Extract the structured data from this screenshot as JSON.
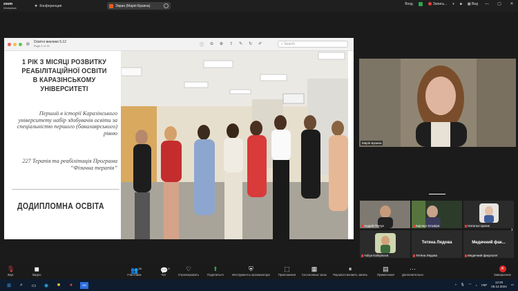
{
  "topbar": {
    "brand_line1": "zoom",
    "brand_line2": "Workplace",
    "conference_label": "Конференция",
    "share_label": "Экран (Марія Брзина)",
    "enter_label": "Вход",
    "record_label": "Запись...",
    "view_label": "Вид",
    "colors": {
      "record": "#e24040",
      "security": "#2ea44f"
    }
  },
  "viewer": {
    "doc_title": "Освітні виклики 5.12",
    "doc_subtitle": "Page 4 of 15",
    "search_placeholder": "Search"
  },
  "slide": {
    "title": "1 РІК З МІСЯЦІ РОЗВИТКУ РЕАБІЛІТАЦІЙНОЇ ОСВІТИ В КАРАЗІНСЬКОМУ УНІВЕРСИТЕТІ",
    "body": "Перший в історії Каразінського університету набір здобувачів освіти за спеціальністю першого (бакалаврського) рівню",
    "body2": "227 Терапія та реабілітація Програма “Фізична терапія”",
    "footer": "ДОДИПЛОМНА ОСВІТА"
  },
  "main_video": {
    "name": "Марія Брзина"
  },
  "participants": [
    {
      "name": "Андрій Пінчук",
      "muted": true
    },
    {
      "name": "Карчаус Ельвіра",
      "muted": true
    },
    {
      "name": "Наталья Цалик",
      "muted": true
    },
    {
      "name": "Yuliya Kalnytsova",
      "muted": true
    },
    {
      "name": "Тетяна Лядова",
      "display": "Тетяна Лядова",
      "muted": true
    },
    {
      "name": "Медичний факультет",
      "display": "Медичний фак...",
      "muted": true
    }
  ],
  "toolbar": {
    "audio": "Звук",
    "video": "Видео",
    "participants": "Участники",
    "participants_count": "20",
    "chat": "Чат",
    "chat_count": "3",
    "react": "Отреагировать",
    "share": "Поделиться",
    "host_tools": "Инструменты организатора",
    "apps": "Приложения",
    "rooms": "Сессионные залы",
    "pause_share": "Пауза/остановить запись",
    "notes": "Примечания",
    "more": "Дополнительно",
    "end": "Завершение"
  },
  "taskbar": {
    "lang": "УКР",
    "time": "12:20",
    "date": "05.12.2024",
    "zoom_label": "ZM"
  }
}
